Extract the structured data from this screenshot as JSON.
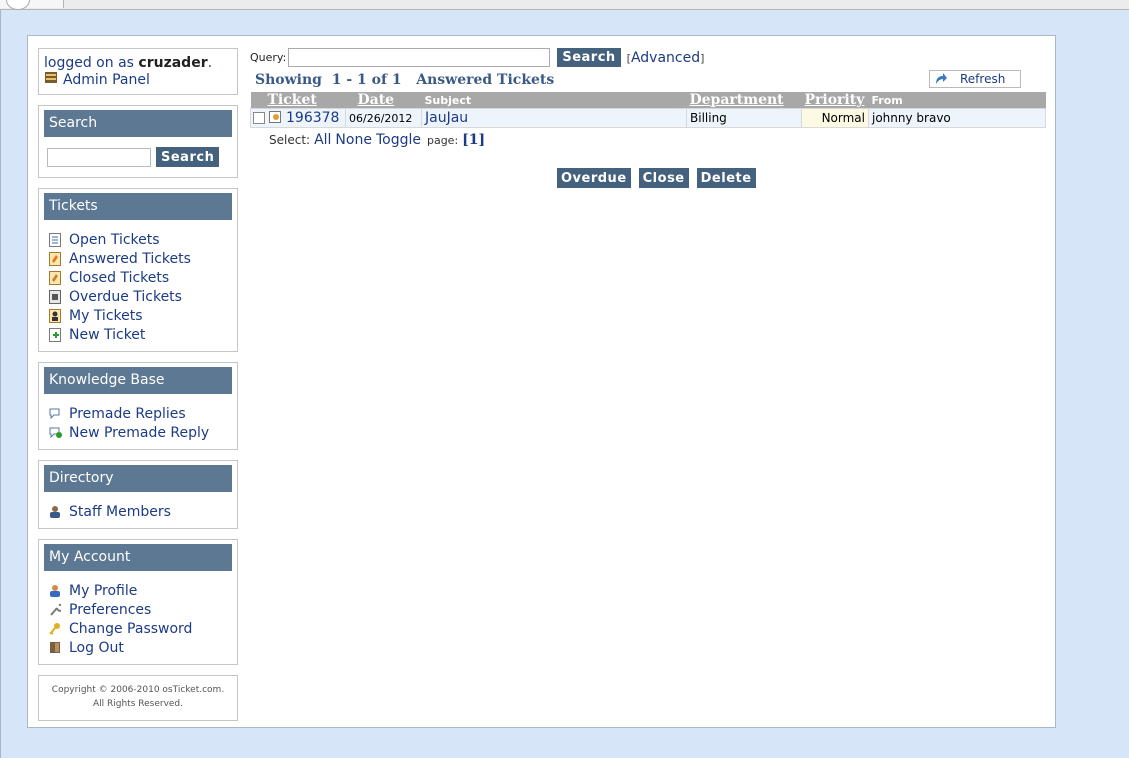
{
  "login": {
    "prefix": "logged on as",
    "username": "cruzader",
    "suffix": ".",
    "admin_panel": "Admin Panel"
  },
  "search": {
    "title": "Search",
    "button": "Search",
    "value": ""
  },
  "tickets_nav": {
    "title": "Tickets",
    "items": [
      {
        "label": "Open Tickets",
        "icon": "open-tickets-icon"
      },
      {
        "label": "Answered Tickets",
        "icon": "answered-tickets-icon"
      },
      {
        "label": "Closed Tickets",
        "icon": "closed-tickets-icon"
      },
      {
        "label": "Overdue Tickets",
        "icon": "overdue-tickets-icon"
      },
      {
        "label": "My Tickets",
        "icon": "my-tickets-icon"
      },
      {
        "label": "New Ticket",
        "icon": "new-ticket-icon"
      }
    ]
  },
  "kb": {
    "title": "Knowledge Base",
    "items": [
      {
        "label": "Premade Replies",
        "icon": "premade-replies-icon"
      },
      {
        "label": "New Premade Reply",
        "icon": "new-premade-reply-icon"
      }
    ]
  },
  "directory": {
    "title": "Directory",
    "items": [
      {
        "label": "Staff Members",
        "icon": "staff-icon"
      }
    ]
  },
  "account": {
    "title": "My Account",
    "items": [
      {
        "label": "My Profile",
        "icon": "profile-icon"
      },
      {
        "label": "Preferences",
        "icon": "wrench-icon"
      },
      {
        "label": "Change Password",
        "icon": "key-icon"
      },
      {
        "label": "Log Out",
        "icon": "logout-door-icon"
      }
    ]
  },
  "copyright": {
    "line1": "Copyright © 2006-2010 osTicket.com.",
    "line2": "All Rights Reserved."
  },
  "query": {
    "label": "Query:",
    "value": "",
    "button": "Search",
    "advanced_open": "[",
    "advanced": "Advanced",
    "advanced_close": "]"
  },
  "showing": {
    "text": "Showing  1 - 1 of 1   Answered Tickets",
    "refresh": "Refresh"
  },
  "table": {
    "headers": {
      "ticket": "Ticket",
      "date": "Date",
      "subject": "Subject",
      "department": "Department",
      "priority": "Priority",
      "from": "From"
    },
    "rows": [
      {
        "ticket": "196378",
        "date": "06/26/2012",
        "subject": "JauJau",
        "department": "Billing",
        "priority": "Normal",
        "from": "johnny bravo"
      }
    ]
  },
  "select": {
    "label": "Select:",
    "all": "All",
    "none": "None",
    "toggle": "Toggle",
    "page_label": "page:",
    "page": "[1]"
  },
  "actions": {
    "overdue": "Overdue",
    "close": "Close",
    "delete": "Delete"
  },
  "colors": {
    "header_blue": "#5c7893",
    "button": "#44617e",
    "link": "#1c3b86",
    "page_bg": "#d6e5f7"
  }
}
